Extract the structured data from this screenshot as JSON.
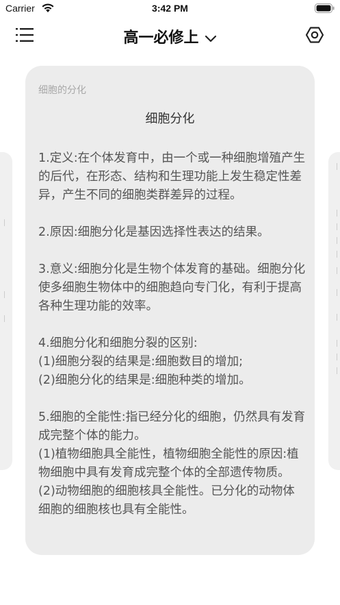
{
  "status_bar": {
    "carrier": "Carrier",
    "time": "3:42 PM"
  },
  "nav": {
    "title": "高一必修上"
  },
  "card": {
    "small_title": "细胞的分化",
    "heading": "细胞分化",
    "paragraphs": [
      [
        "1.定义:在个体发育中，由一个或一种细胞增殖产生的后代，在形态、结构和生理功能上发生稳定性差异，产生不同的细胞类群差异的过程。"
      ],
      [
        "2.原因:细胞分化是基因选择性表达的结果。"
      ],
      [
        "3.意义:细胞分化是生物个体发育的基础。细胞分化使多细胞生物体中的细胞趋向专门化，有利于提高各种生理功能的效率。"
      ],
      [
        "4.细胞分化和细胞分裂的区别:",
        "(1)细胞分裂的结果是:细胞数目的增加;",
        "(2)细胞分化的结果是:细胞种类的增加。"
      ],
      [
        "5.细胞的全能性:指已经分化的细胞，仍然具有发育成完整个体的能力。",
        "(1)植物细胞具全能性，植物细胞全能性的原因:植物细胞中具有发育成完整个体的全部遗传物质。",
        "(2)动物细胞的细胞核具全能性。已分化的动物体细胞的细胞核也具有全能性。"
      ]
    ]
  }
}
